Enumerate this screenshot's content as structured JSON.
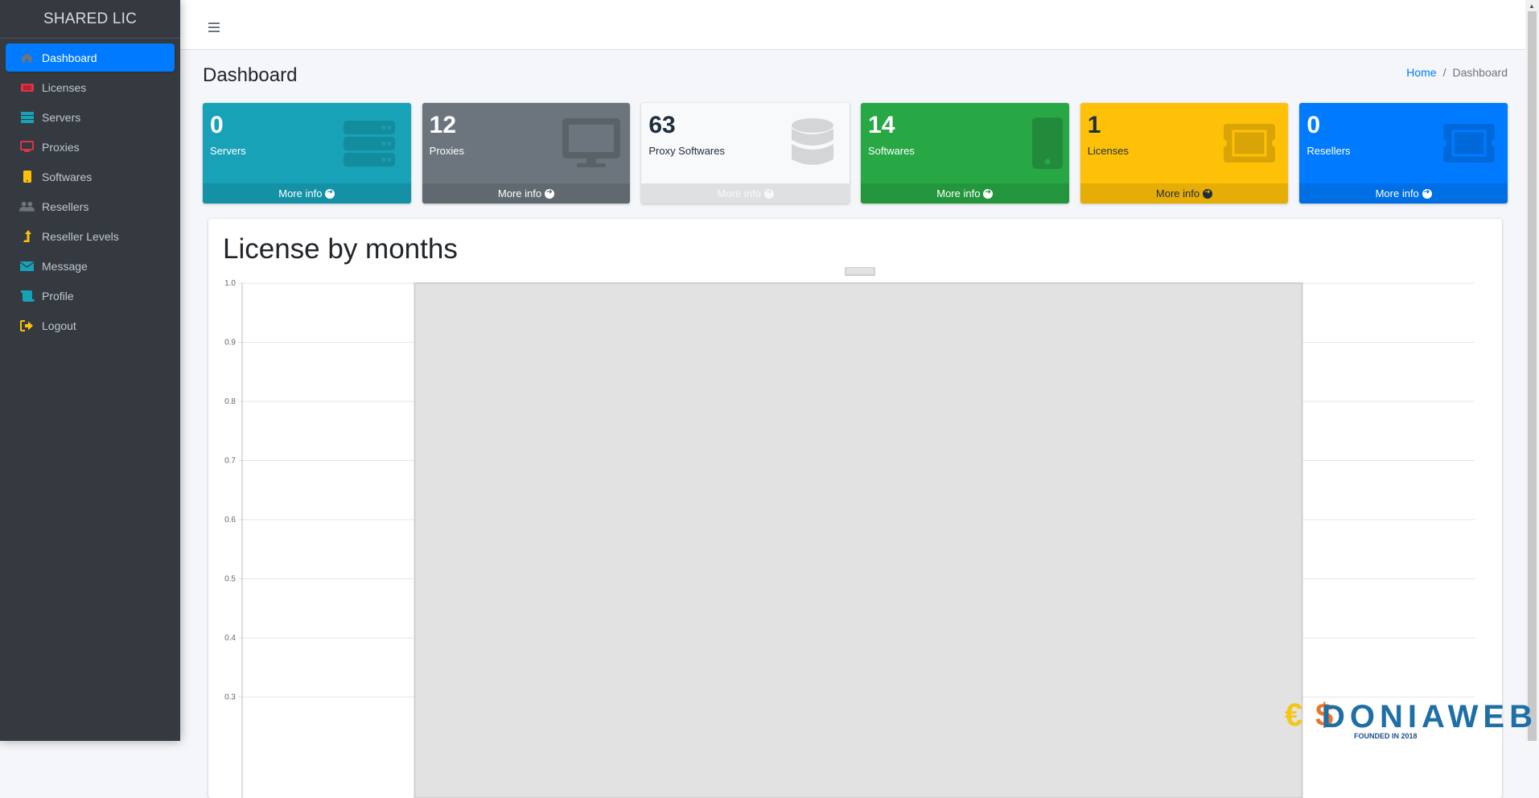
{
  "app": {
    "brand": "SHARED LIC"
  },
  "sidebar": {
    "items": [
      {
        "label": "Dashboard",
        "icon": "home-icon",
        "active": true
      },
      {
        "label": "Licenses",
        "icon": "ticket-icon"
      },
      {
        "label": "Servers",
        "icon": "server-icon"
      },
      {
        "label": "Proxies",
        "icon": "desktop-icon"
      },
      {
        "label": "Softwares",
        "icon": "mobile-icon"
      },
      {
        "label": "Resellers",
        "icon": "users-icon"
      },
      {
        "label": "Reseller Levels",
        "icon": "level-up-icon"
      },
      {
        "label": "Message",
        "icon": "envelope-icon"
      },
      {
        "label": "Profile",
        "icon": "scroll-icon"
      },
      {
        "label": "Logout",
        "icon": "sign-out-icon"
      }
    ]
  },
  "header": {
    "title": "Dashboard",
    "breadcrumb": {
      "home": "Home",
      "separator": "/",
      "current": "Dashboard"
    }
  },
  "stats": [
    {
      "value": "0",
      "label": "Servers",
      "more": "More info",
      "icon": "server-icon",
      "color": "#17a2b8"
    },
    {
      "value": "12",
      "label": "Proxies",
      "more": "More info",
      "icon": "desktop-icon",
      "color": "#6c757d"
    },
    {
      "value": "63",
      "label": "Proxy Softwares",
      "more": "More info",
      "icon": "database-icon",
      "color": "#f8f9fa"
    },
    {
      "value": "14",
      "label": "Softwares",
      "more": "More info",
      "icon": "mobile-icon",
      "color": "#28a745"
    },
    {
      "value": "1",
      "label": "Licenses",
      "more": "More info",
      "icon": "ticket-icon",
      "color": "#ffc107"
    },
    {
      "value": "0",
      "label": "Resellers",
      "more": "More info",
      "icon": "ticket-icon",
      "color": "#007bff"
    }
  ],
  "chart_card": {
    "title": "License by months"
  },
  "chart_data": {
    "type": "bar",
    "title": "License by months",
    "categories": [
      ""
    ],
    "series": [
      {
        "name": "",
        "values": [
          1
        ]
      }
    ],
    "legend": "top",
    "xlabel": "",
    "ylabel": "",
    "ylim_visible": [
      0.3,
      1.0
    ],
    "yticks": [
      "1.0",
      "0.9",
      "0.8",
      "0.7",
      "0.6",
      "0.5",
      "0.4",
      "0.3"
    ],
    "grid": true,
    "bar_color": "#e2e2e2"
  },
  "watermark": {
    "text": "DONIAWEB",
    "subtext": "FOUNDED IN 2018"
  }
}
